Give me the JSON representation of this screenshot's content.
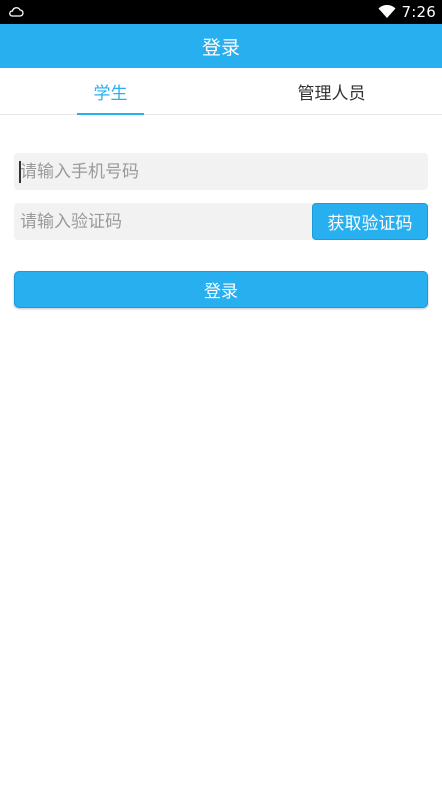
{
  "status_bar": {
    "time": "7:26",
    "left_icon": "cloud-notification-icon",
    "right_icon": "wifi-icon",
    "background": "#000000"
  },
  "app_bar": {
    "title": "登录",
    "background": "#27aff0"
  },
  "tabs": [
    {
      "label": "学生",
      "active": true
    },
    {
      "label": "管理人员",
      "active": false
    }
  ],
  "form": {
    "phone_placeholder": "请输入手机号码",
    "phone_value": "",
    "code_placeholder": "请输入验证码",
    "code_value": "",
    "get_code_label": "获取验证码",
    "login_label": "登录"
  },
  "colors": {
    "accent": "#27aff0",
    "field_bg": "#f2f2f2",
    "placeholder": "#9a9a9a"
  }
}
